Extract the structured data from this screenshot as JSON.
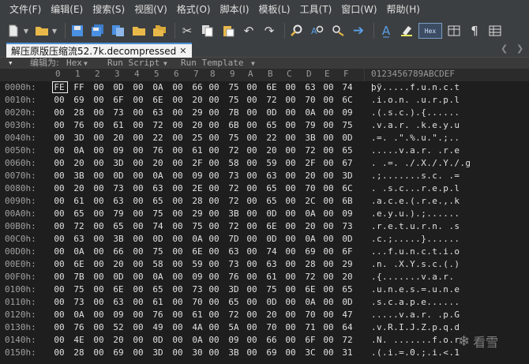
{
  "menubar": {
    "items": [
      "文件(F)",
      "编辑(E)",
      "搜索(S)",
      "视图(V)",
      "格式(O)",
      "脚本(I)",
      "模板(L)",
      "工具(T)",
      "窗口(W)",
      "帮助(H)"
    ]
  },
  "toolbar": {
    "icons": [
      "new-file-icon",
      "open-folder-icon",
      "save-icon",
      "save-all-icon",
      "copy-file-icon",
      "folder-icon",
      "folders-icon",
      "cut-icon",
      "copy-icon",
      "paste-icon",
      "undo-icon",
      "redo-icon",
      "find-icon",
      "find-replace-icon",
      "find-next-icon",
      "goto-icon",
      "font-icon",
      "highlight-icon",
      "hex-mode-icon",
      "columns-icon",
      "pilcrow-icon",
      "table-icon"
    ],
    "hex_label": "Hex"
  },
  "tab": {
    "title": "解压原版压缩流52.7k.decompressed",
    "close": "✕"
  },
  "editbar": {
    "arrow": "▾",
    "edit_as_label": "编辑为: ",
    "edit_as_value": "Hex",
    "run_script": "Run Script",
    "run_template": "Run Template"
  },
  "hex_header": {
    "columns": [
      "0",
      "1",
      "2",
      "3",
      "4",
      "5",
      "6",
      "7",
      "8",
      "9",
      "A",
      "B",
      "C",
      "D",
      "E",
      "F"
    ],
    "ascii_header": "0123456789ABCDEF"
  },
  "rows": [
    {
      "addr": "0000h:",
      "bytes": [
        "FE",
        "FF",
        "00",
        "0D",
        "00",
        "0A",
        "00",
        "66",
        "00",
        "75",
        "00",
        "6E",
        "00",
        "63",
        "00",
        "74"
      ],
      "ascii": "þÿ.....f.u.n.c.t"
    },
    {
      "addr": "0010h:",
      "bytes": [
        "00",
        "69",
        "00",
        "6F",
        "00",
        "6E",
        "00",
        "20",
        "00",
        "75",
        "00",
        "72",
        "00",
        "70",
        "00",
        "6C"
      ],
      "ascii": ".i.o.n. .u.r.p.l"
    },
    {
      "addr": "0020h:",
      "bytes": [
        "00",
        "28",
        "00",
        "73",
        "00",
        "63",
        "00",
        "29",
        "00",
        "7B",
        "00",
        "0D",
        "00",
        "0A",
        "00",
        "09"
      ],
      "ascii": ".(.s.c.).{......"
    },
    {
      "addr": "0030h:",
      "bytes": [
        "00",
        "76",
        "00",
        "61",
        "00",
        "72",
        "00",
        "20",
        "00",
        "6B",
        "00",
        "65",
        "00",
        "79",
        "00",
        "75"
      ],
      "ascii": ".v.a.r. .k.e.y.u"
    },
    {
      "addr": "0040h:",
      "bytes": [
        "00",
        "3D",
        "00",
        "20",
        "00",
        "22",
        "00",
        "25",
        "00",
        "75",
        "00",
        "22",
        "00",
        "3B",
        "00",
        "0D"
      ],
      "ascii": ".=. .\".%.u.\".;.."
    },
    {
      "addr": "0050h:",
      "bytes": [
        "00",
        "0A",
        "00",
        "09",
        "00",
        "76",
        "00",
        "61",
        "00",
        "72",
        "00",
        "20",
        "00",
        "72",
        "00",
        "65"
      ],
      "ascii": ".....v.a.r. .r.e"
    },
    {
      "addr": "0060h:",
      "bytes": [
        "00",
        "20",
        "00",
        "3D",
        "00",
        "20",
        "00",
        "2F",
        "00",
        "58",
        "00",
        "59",
        "00",
        "2F",
        "00",
        "67"
      ],
      "ascii": ". .=. ./.X./.Y./.g"
    },
    {
      "addr": "0070h:",
      "bytes": [
        "00",
        "3B",
        "00",
        "0D",
        "00",
        "0A",
        "00",
        "09",
        "00",
        "73",
        "00",
        "63",
        "00",
        "20",
        "00",
        "3D"
      ],
      "ascii": ".;.......s.c. .="
    },
    {
      "addr": "0080h:",
      "bytes": [
        "00",
        "20",
        "00",
        "73",
        "00",
        "63",
        "00",
        "2E",
        "00",
        "72",
        "00",
        "65",
        "00",
        "70",
        "00",
        "6C"
      ],
      "ascii": ". .s.c...r.e.p.l"
    },
    {
      "addr": "0090h:",
      "bytes": [
        "00",
        "61",
        "00",
        "63",
        "00",
        "65",
        "00",
        "28",
        "00",
        "72",
        "00",
        "65",
        "00",
        "2C",
        "00",
        "6B"
      ],
      "ascii": ".a.c.e.(.r.e.,.k"
    },
    {
      "addr": "00A0h:",
      "bytes": [
        "00",
        "65",
        "00",
        "79",
        "00",
        "75",
        "00",
        "29",
        "00",
        "3B",
        "00",
        "0D",
        "00",
        "0A",
        "00",
        "09"
      ],
      "ascii": ".e.y.u.).;......"
    },
    {
      "addr": "00B0h:",
      "bytes": [
        "00",
        "72",
        "00",
        "65",
        "00",
        "74",
        "00",
        "75",
        "00",
        "72",
        "00",
        "6E",
        "00",
        "20",
        "00",
        "73"
      ],
      "ascii": ".r.e.t.u.r.n. .s"
    },
    {
      "addr": "00C0h:",
      "bytes": [
        "00",
        "63",
        "00",
        "3B",
        "00",
        "0D",
        "00",
        "0A",
        "00",
        "7D",
        "00",
        "0D",
        "00",
        "0A",
        "00",
        "0D"
      ],
      "ascii": ".c.;.....}......"
    },
    {
      "addr": "00D0h:",
      "bytes": [
        "00",
        "0A",
        "00",
        "66",
        "00",
        "75",
        "00",
        "6E",
        "00",
        "63",
        "00",
        "74",
        "00",
        "69",
        "00",
        "6F"
      ],
      "ascii": "...f.u.n.c.t.i.o"
    },
    {
      "addr": "00E0h:",
      "bytes": [
        "00",
        "6E",
        "00",
        "20",
        "00",
        "58",
        "00",
        "59",
        "00",
        "73",
        "00",
        "63",
        "00",
        "28",
        "00",
        "29"
      ],
      "ascii": ".n. .X.Y.s.c.(.)"
    },
    {
      "addr": "00F0h:",
      "bytes": [
        "00",
        "7B",
        "00",
        "0D",
        "00",
        "0A",
        "00",
        "09",
        "00",
        "76",
        "00",
        "61",
        "00",
        "72",
        "00",
        "20"
      ],
      "ascii": ".{.......v.a.r. "
    },
    {
      "addr": "0100h:",
      "bytes": [
        "00",
        "75",
        "00",
        "6E",
        "00",
        "65",
        "00",
        "73",
        "00",
        "3D",
        "00",
        "75",
        "00",
        "6E",
        "00",
        "65"
      ],
      "ascii": ".u.n.e.s.=.u.n.e"
    },
    {
      "addr": "0110h:",
      "bytes": [
        "00",
        "73",
        "00",
        "63",
        "00",
        "61",
        "00",
        "70",
        "00",
        "65",
        "00",
        "0D",
        "00",
        "0A",
        "00",
        "0D"
      ],
      "ascii": ".s.c.a.p.e......"
    },
    {
      "addr": "0120h:",
      "bytes": [
        "00",
        "0A",
        "00",
        "09",
        "00",
        "76",
        "00",
        "61",
        "00",
        "72",
        "00",
        "20",
        "00",
        "70",
        "00",
        "47"
      ],
      "ascii": ".....v.a.r. .p.G"
    },
    {
      "addr": "0130h:",
      "bytes": [
        "00",
        "76",
        "00",
        "52",
        "00",
        "49",
        "00",
        "4A",
        "00",
        "5A",
        "00",
        "70",
        "00",
        "71",
        "00",
        "64"
      ],
      "ascii": ".v.R.I.J.Z.p.q.d"
    },
    {
      "addr": "0140h:",
      "bytes": [
        "00",
        "4E",
        "00",
        "20",
        "00",
        "0D",
        "00",
        "0A",
        "00",
        "09",
        "00",
        "66",
        "00",
        "6F",
        "00",
        "72"
      ],
      "ascii": ".N. .......f.o.r"
    },
    {
      "addr": "0150h:",
      "bytes": [
        "00",
        "28",
        "00",
        "69",
        "00",
        "3D",
        "00",
        "30",
        "00",
        "3B",
        "00",
        "69",
        "00",
        "3C",
        "00",
        "31"
      ],
      "ascii": ".(.i.=.0.;.i.<.1"
    }
  ],
  "watermark": {
    "text": "看雪"
  }
}
